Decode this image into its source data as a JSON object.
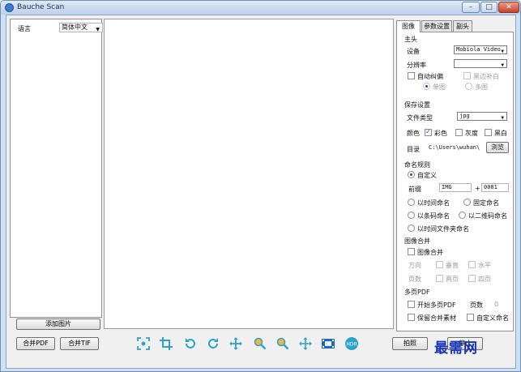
{
  "window": {
    "title": "Bauche Scan",
    "minimize": "–",
    "maximize": "□",
    "close": "✕"
  },
  "left": {
    "language_label": "语言",
    "language_value": "简体中文",
    "add_image": "添加图片",
    "merge_pdf": "合并PDF",
    "merge_tif": "合并TIF"
  },
  "toolbar": {
    "icons": [
      "focus-icon",
      "crop-icon",
      "rotate-left-icon",
      "rotate-right-icon",
      "move-icon",
      "zoom-in-icon",
      "zoom-out-icon",
      "center-icon",
      "film-icon",
      "hd-icon"
    ]
  },
  "bottom": {
    "capture": "拍照",
    "stop_label": "停止"
  },
  "tabs": [
    "图像",
    "参数设置",
    "副头"
  ],
  "panel": {
    "main_header": "主头",
    "device_label": "设备",
    "device_value": "Mobiola Video",
    "resolution_label": "分辨率",
    "resolution_value": "",
    "auto_crop": "自动纠偏",
    "fill_border": "黑边补白",
    "single": "单图",
    "multi": "多图",
    "save_header": "保存设置",
    "filetype_label": "文件类型",
    "filetype_value": "jpg",
    "color_label": "颜色",
    "color_opt": "彩色",
    "gray_opt": "灰度",
    "bw_opt": "黑白",
    "dir_label": "目录",
    "dir_value": "C:\\Users\\wuhan\\",
    "browse": "浏览",
    "naming_header": "命名规则",
    "custom": "自定义",
    "prefix_label": "前缀",
    "prefix_value": "IMG",
    "plus": "+",
    "counter_value": "0001",
    "time_name": "以时间命名",
    "fixed_name": "固定命名",
    "barcode_name": "以条码命名",
    "qrcode_name": "以二维码命名",
    "time_folder": "以时间文件夹命名",
    "merge_header": "图像合并",
    "merge_cb": "图像合并",
    "direction": "方向",
    "vertical": "垂直",
    "horizontal": "水平",
    "pages": "页数",
    "two_pages": "两页",
    "four_pages": "四页",
    "multipdf_header": "多页PDF",
    "start_multipdf": "开始多页PDF",
    "page_count_label": "页数",
    "page_count_value": "0",
    "keep_merge": "保留合并素材",
    "custom_name": "自定义命名"
  },
  "watermark": "最需网"
}
